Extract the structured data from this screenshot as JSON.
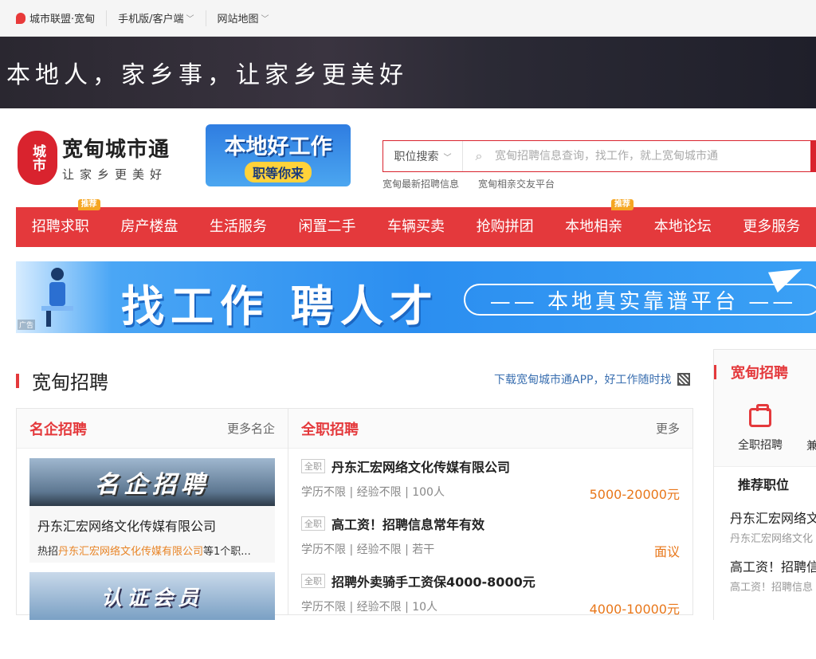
{
  "topbar": {
    "city": "城市联盟·宽甸",
    "mobile": "手机版/客户端",
    "sitemap": "网站地图"
  },
  "banner": {
    "slogan": "本地人，家乡事，让家乡更美好"
  },
  "logo": {
    "seal": "城市",
    "name": "宽甸城市通",
    "tagline": "让家乡更美好"
  },
  "promo": {
    "line1": "本地好工作",
    "line2": "职等你来"
  },
  "search": {
    "category": "职位搜索",
    "placeholder": "宽甸招聘信息查询，找工作，就上宽甸城市通",
    "hot": [
      "宽甸最新招聘信息",
      "宽甸相亲交友平台"
    ]
  },
  "nav": [
    {
      "label": "招聘求职",
      "badge": "推荐"
    },
    {
      "label": "房产楼盘",
      "badge": ""
    },
    {
      "label": "生活服务",
      "badge": ""
    },
    {
      "label": "闲置二手",
      "badge": ""
    },
    {
      "label": "车辆买卖",
      "badge": ""
    },
    {
      "label": "抢购拼团",
      "badge": ""
    },
    {
      "label": "本地相亲",
      "badge": "推荐"
    },
    {
      "label": "本地论坛",
      "badge": ""
    },
    {
      "label": "更多服务",
      "badge": ""
    }
  ],
  "ad": {
    "label": "广告",
    "headline": "找工作 聘人才",
    "pill": "—— 本地真实靠谱平台 ——"
  },
  "section": {
    "title": "宽甸招聘",
    "app_link": "下载宽甸城市通APP，好工作随时找"
  },
  "famous": {
    "title": "名企招聘",
    "more": "更多名企",
    "banner1": "名企招聘",
    "company": "丹东汇宏网络文化传媒有限公司",
    "hot_prefix": "热招",
    "hot_company": "丹东汇宏网络文化传媒有限公司",
    "hot_suffix": "等1个职...",
    "banner2": "认证会员"
  },
  "fulltime": {
    "title": "全职招聘",
    "more": "更多",
    "jobs": [
      {
        "tag": "全职",
        "title": "丹东汇宏网络文化传媒有限公司",
        "meta": "学历不限 | 经验不限 | 100人",
        "pay": "5000-20000元"
      },
      {
        "tag": "全职",
        "title": "高工资！招聘信息常年有效",
        "meta": "学历不限 | 经验不限 | 若干",
        "pay": "面议"
      },
      {
        "tag": "全职",
        "title": "招聘外卖骑手工资保4000-8000元",
        "meta": "学历不限 | 经验不限 | 10人",
        "pay": "4000-10000元"
      }
    ]
  },
  "side": {
    "title": "宽甸招聘",
    "icon1": "全职招聘",
    "icon2": "兼",
    "tab": "推荐职位",
    "recs": [
      {
        "t": "丹东汇宏网络文",
        "s": "丹东汇宏网络文化"
      },
      {
        "t": "高工资！招聘信",
        "s": "高工资！招聘信息"
      }
    ]
  }
}
